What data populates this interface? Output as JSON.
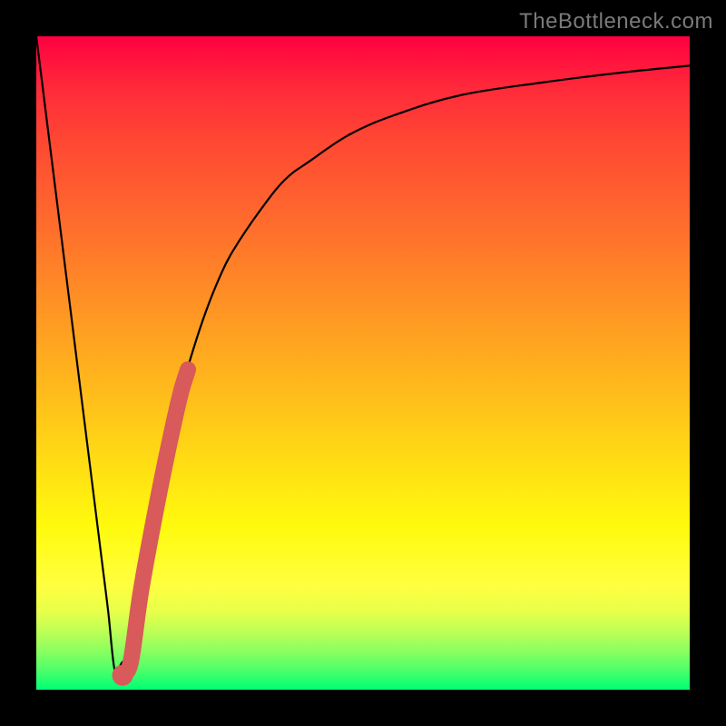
{
  "watermark": "TheBottleneck.com",
  "colors": {
    "frame": "#000000",
    "curve": "#000000",
    "marker": "#d85a5a",
    "gradient_top": "#ff0040",
    "gradient_bottom": "#00ff74"
  },
  "chart_data": {
    "type": "line",
    "title": "",
    "xlabel": "",
    "ylabel": "",
    "xlim": [
      0,
      100
    ],
    "ylim": [
      0,
      100
    ],
    "legend": false,
    "grid": false,
    "description": "V-shaped bottleneck curve with steep left descent and asymptotic right rise, plotted over a vertical heat gradient background. Minimum near x≈12.",
    "series": [
      {
        "name": "bottleneck_curve",
        "x": [
          0,
          2,
          4,
          6,
          8,
          10,
          11,
          12,
          13,
          14,
          16,
          18,
          20,
          22,
          24,
          26,
          28,
          30,
          34,
          38,
          42,
          48,
          55,
          65,
          78,
          90,
          100
        ],
        "y": [
          100,
          84,
          68,
          52,
          36,
          20,
          12,
          3,
          4,
          6,
          15,
          26,
          36,
          45,
          52,
          58,
          63,
          67,
          73,
          78,
          81,
          85,
          88,
          91,
          93,
          94.5,
          95.5
        ]
      }
    ],
    "highlighted_segment": {
      "name": "marker_band",
      "x": [
        13.5,
        14.5,
        16,
        18,
        20,
        22,
        23.2
      ],
      "y": [
        2.5,
        4.5,
        15,
        26,
        36,
        45,
        49
      ]
    },
    "marker_point": {
      "x": 13.2,
      "y": 2.2
    }
  }
}
